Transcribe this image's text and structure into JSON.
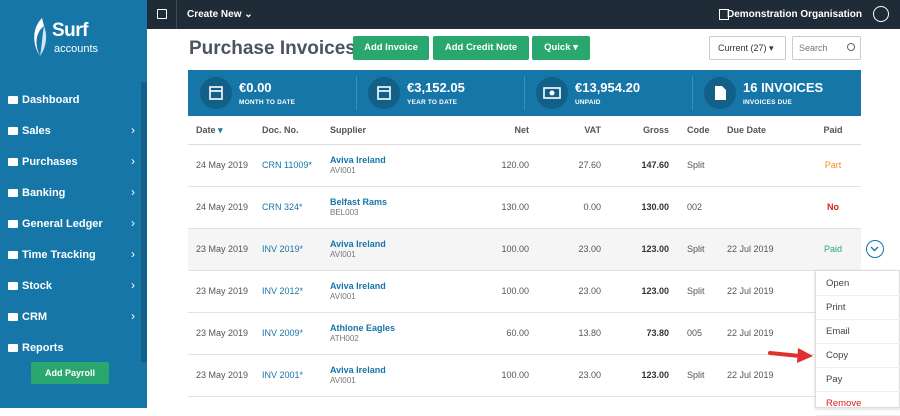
{
  "brand": {
    "name": "Surf",
    "tagline": "accounts"
  },
  "sidebar": {
    "items": [
      {
        "label": "Dashboard",
        "icon": "dashboard-icon",
        "chev": ""
      },
      {
        "label": "Sales",
        "icon": "briefcase-icon",
        "chev": "›"
      },
      {
        "label": "Purchases",
        "icon": "purchases-icon",
        "chev": "›"
      },
      {
        "label": "Banking",
        "icon": "bank-icon",
        "chev": "›"
      },
      {
        "label": "General Ledger",
        "icon": "ledger-icon",
        "chev": "›"
      },
      {
        "label": "Time Tracking",
        "icon": "clock-icon",
        "chev": "›"
      },
      {
        "label": "Stock",
        "icon": "chart-icon",
        "chev": "›"
      },
      {
        "label": "CRM",
        "icon": "globe-icon",
        "chev": "›"
      },
      {
        "label": "Reports",
        "icon": "table-icon",
        "chev": ""
      }
    ],
    "add_payroll": "Add Payroll"
  },
  "topbar": {
    "create_new": "Create New",
    "org": "Demonstration Organisation"
  },
  "page": {
    "title": "Purchase Invoices"
  },
  "toolbar": {
    "add_invoice": "Add Invoice",
    "add_credit_note": "Add Credit Note",
    "quick": "Quick",
    "current": "Current (27)",
    "search_placeholder": "Search"
  },
  "stats": [
    {
      "value": "€0.00",
      "label": "MONTH TO DATE",
      "icon": "calendar-icon"
    },
    {
      "value": "€3,152.05",
      "label": "YEAR TO DATE",
      "icon": "calendar-icon"
    },
    {
      "value": "€13,954.20",
      "label": "UNPAID",
      "icon": "money-icon"
    },
    {
      "value": "16 INVOICES",
      "label": "INVOICES DUE",
      "icon": "document-icon"
    }
  ],
  "table": {
    "headers": [
      "Date",
      "Doc. No.",
      "Supplier",
      "Net",
      "VAT",
      "Gross",
      "Code",
      "Due Date",
      "Paid"
    ],
    "rows": [
      {
        "date": "24 May 2019",
        "doc": "CRN 11009*",
        "supplier": "Aviva Ireland",
        "code_sup": "AVI001",
        "net": "120.00",
        "vat": "27.60",
        "gross": "147.60",
        "code": "Split",
        "due": "",
        "paid": "Part"
      },
      {
        "date": "24 May 2019",
        "doc": "CRN 324*",
        "supplier": "Belfast Rams",
        "code_sup": "BEL003",
        "net": "130.00",
        "vat": "0.00",
        "gross": "130.00",
        "code": "002",
        "due": "",
        "paid": "No"
      },
      {
        "date": "23 May 2019",
        "doc": "INV 2019*",
        "supplier": "Aviva Ireland",
        "code_sup": "AVI001",
        "net": "100.00",
        "vat": "23.00",
        "gross": "123.00",
        "code": "Split",
        "due": "22 Jul 2019",
        "paid": "Paid"
      },
      {
        "date": "23 May 2019",
        "doc": "INV 2012*",
        "supplier": "Aviva Ireland",
        "code_sup": "AVI001",
        "net": "100.00",
        "vat": "23.00",
        "gross": "123.00",
        "code": "Split",
        "due": "22 Jul 2019",
        "paid": ""
      },
      {
        "date": "23 May 2019",
        "doc": "INV 2009*",
        "supplier": "Athlone Eagles",
        "code_sup": "ATH002",
        "net": "60.00",
        "vat": "13.80",
        "gross": "73.80",
        "code": "005",
        "due": "22 Jul 2019",
        "paid": ""
      },
      {
        "date": "23 May 2019",
        "doc": "INV 2001*",
        "supplier": "Aviva Ireland",
        "code_sup": "AVI001",
        "net": "100.00",
        "vat": "23.00",
        "gross": "123.00",
        "code": "Split",
        "due": "22 Jul 2019",
        "paid": ""
      }
    ]
  },
  "context_menu": [
    "Open",
    "Print",
    "Email",
    "Copy",
    "Pay",
    "Remove"
  ],
  "colors": {
    "brand": "#1676a8",
    "green": "#2aa76f",
    "dark": "#1f2b36",
    "part": "#f0921a",
    "no": "#d8221d"
  }
}
